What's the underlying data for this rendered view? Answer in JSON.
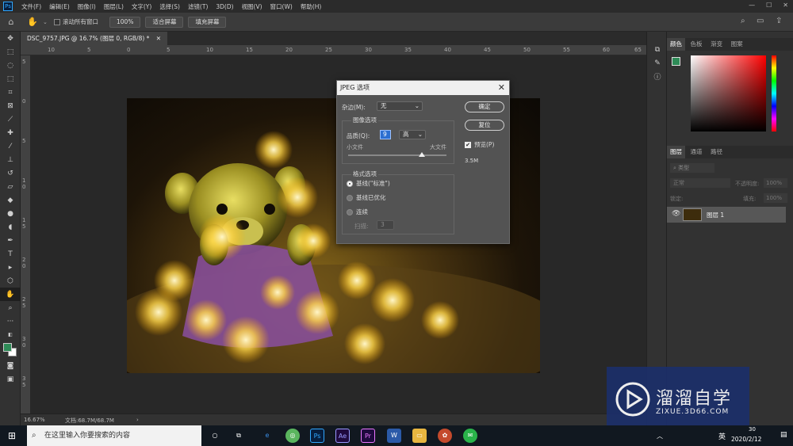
{
  "menubar": {
    "app_icon": "Ps",
    "items": [
      "文件(F)",
      "编辑(E)",
      "图像(I)",
      "图层(L)",
      "文字(Y)",
      "选择(S)",
      "滤镜(T)",
      "3D(D)",
      "视图(V)",
      "窗口(W)",
      "帮助(H)"
    ]
  },
  "options_bar": {
    "tool_icon": "hand-icon",
    "scroll_all_label": "滚动所有窗口",
    "zoom_value": "100%",
    "fit_screen_label": "适合屏幕",
    "fill_screen_label": "填充屏幕"
  },
  "document": {
    "tab_title": "DSC_9757.JPG @ 16.7% (图层 0, RGB/8) *",
    "ruler_h_labels": [
      "10",
      "5",
      "0",
      "5",
      "10",
      "15",
      "20",
      "25",
      "30",
      "35",
      "40",
      "45",
      "50",
      "55",
      "60",
      "65"
    ],
    "ruler_v_labels": [
      "5",
      "0",
      "5",
      "1 0",
      "1 5",
      "2 0",
      "2 5",
      "3 0",
      "3 5"
    ],
    "zoom_status": "16.67%",
    "doc_status": "文档:68.7M/68.7M"
  },
  "jpeg_dialog": {
    "title": "JPEG 选项",
    "matte_label": "杂边(M):",
    "matte_value": "无",
    "ok_label": "确定",
    "reset_label": "复位",
    "preview_label": "预览(P)",
    "preview_checked": true,
    "file_size": "3.5M",
    "image_options_title": "图像选项",
    "quality_label": "品质(Q):",
    "quality_value": "9",
    "quality_preset": "高",
    "small_file_label": "小文件",
    "large_file_label": "大文件",
    "quality_slider_fraction": 0.75,
    "format_options_title": "格式选项",
    "format_options": [
      {
        "label": "基线(\"标准\")",
        "selected": true,
        "enabled": true
      },
      {
        "label": "基线已优化",
        "selected": false,
        "enabled": true
      },
      {
        "label": "连续",
        "selected": false,
        "enabled": true
      }
    ],
    "scans_label": "扫描:",
    "scans_value": "3"
  },
  "panels": {
    "color_tabs": [
      "颜色",
      "色板",
      "渐变",
      "图案"
    ],
    "layer_tabs": [
      "图层",
      "通道",
      "路径"
    ],
    "filter_type": "类型",
    "blend_mode": "正常",
    "opacity_label": "不透明度:",
    "opacity_value": "100%",
    "lock_label": "锁定:",
    "fill_label": "填充:",
    "fill_value": "100%",
    "layers": [
      {
        "name": "图层 1",
        "visible": true
      }
    ]
  },
  "taskbar": {
    "search_placeholder": "在这里输入你要搜索的内容",
    "ime_label": "英",
    "clock_time": "30",
    "clock_date": "2020/2/12"
  },
  "watermark": {
    "brand_text": "溜溜自学",
    "url_text": "ZIXUE.3D66.COM"
  },
  "colors": {
    "arrow": "#e8413a",
    "foreground_swatch": "#2e8b57",
    "watermark_bg": "#1c2f6a"
  }
}
